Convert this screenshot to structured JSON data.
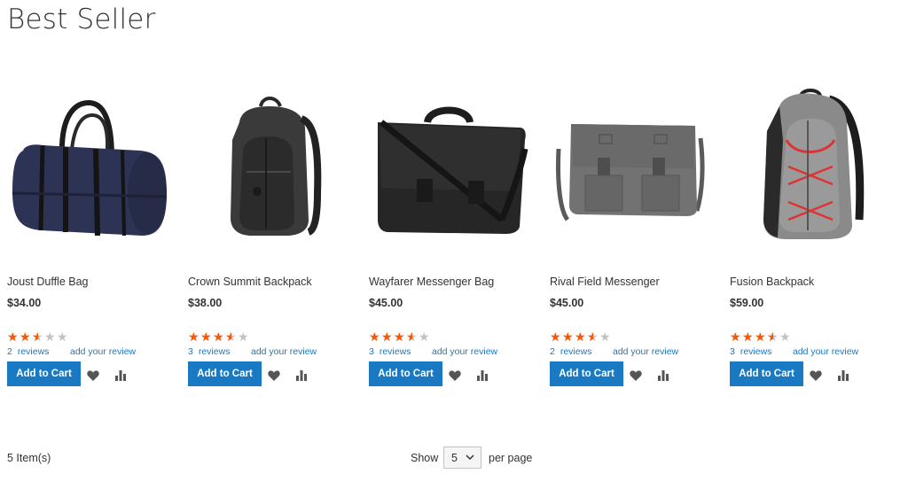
{
  "page": {
    "title": "Best Seller"
  },
  "colors": {
    "accent": "#1979c3",
    "star_filled": "#ff5501",
    "star_empty": "#c2c2c2"
  },
  "products": [
    {
      "name": "Joust Duffle Bag",
      "price": "$34.00",
      "rating": 2.5,
      "reviews_count": "2",
      "reviews_label": "reviews",
      "add_review": "add your review",
      "add_to_cart": "Add to Cart",
      "image": "duffle-bag-image"
    },
    {
      "name": "Crown Summit Backpack",
      "price": "$38.00",
      "rating": 3.5,
      "reviews_count": "3",
      "reviews_label": "reviews",
      "add_review": "add your review",
      "add_to_cart": "Add to Cart",
      "image": "backpack-image"
    },
    {
      "name": "Wayfarer Messenger Bag",
      "price": "$45.00",
      "rating": 3.5,
      "reviews_count": "3",
      "reviews_label": "reviews",
      "add_review": "add your review",
      "add_to_cart": "Add to Cart",
      "image": "messenger-bag-image"
    },
    {
      "name": "Rival Field Messenger",
      "price": "$45.00",
      "rating": 3.5,
      "reviews_count": "2",
      "reviews_label": "reviews",
      "add_review": "add your review",
      "add_to_cart": "Add to Cart",
      "image": "field-messenger-image"
    },
    {
      "name": "Fusion Backpack",
      "price": "$59.00",
      "rating": 3.5,
      "reviews_count": "3",
      "reviews_label": "reviews",
      "add_review": "add your review",
      "add_to_cart": "Add to Cart",
      "image": "fusion-backpack-image"
    }
  ],
  "toolbar": {
    "amount": "5 Item(s)",
    "show_label": "Show",
    "limiter_value": "5",
    "per_page_label": "per page"
  }
}
